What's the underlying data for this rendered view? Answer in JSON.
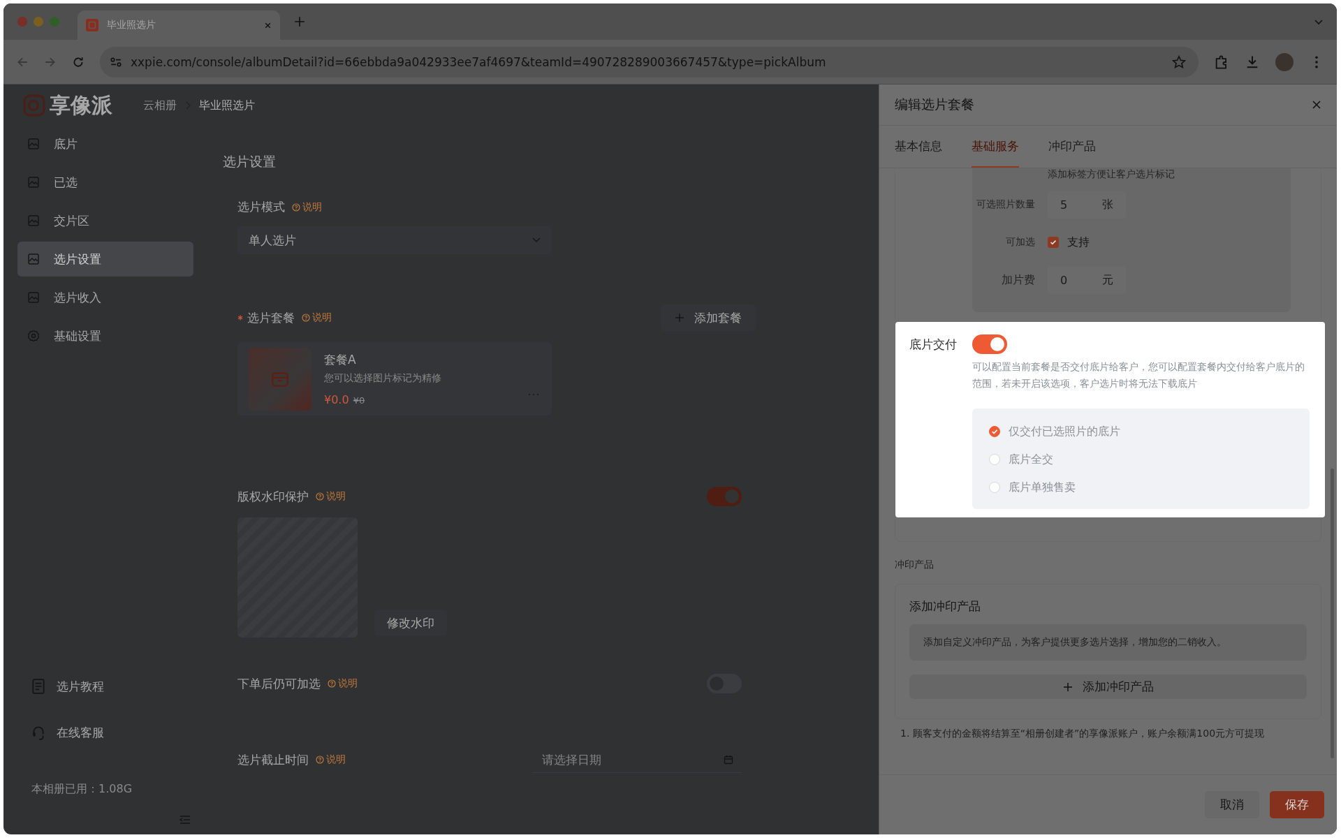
{
  "browser": {
    "tab_title": "毕业照选片",
    "url": "xxpie.com/console/albumDetail?id=66ebbda9a042933ee7af4697&teamId=490728289003667457&type=pickAlbum"
  },
  "app": {
    "logo": "享像派",
    "breadcrumb": [
      "云相册",
      "毕业照选片"
    ],
    "sidebar": {
      "items": [
        {
          "label": "底片",
          "selected": false
        },
        {
          "label": "已选",
          "selected": false
        },
        {
          "label": "交片区",
          "selected": false
        },
        {
          "label": "选片设置",
          "selected": true
        },
        {
          "label": "选片收入",
          "selected": false
        },
        {
          "label": "基础设置",
          "selected": false
        }
      ],
      "links": [
        "选片教程",
        "在线客服"
      ],
      "storage": "本相册已用：1.08G"
    }
  },
  "settings": {
    "title": "选片设置",
    "mode": {
      "label": "选片模式",
      "help": "说明",
      "value": "单人选片"
    },
    "package": {
      "label": "选片套餐",
      "required": true,
      "help": "说明",
      "add": "添加套餐",
      "items": [
        {
          "name": "套餐A",
          "desc": "您可以选择图片标记为精修",
          "price": "¥0.0",
          "original_price": "¥0"
        }
      ]
    },
    "watermark": {
      "label": "版权水印保护",
      "help": "说明",
      "on": true,
      "edit": "修改水印"
    },
    "addon": {
      "label": "下单后仍可加选",
      "help": "说明",
      "on": false
    },
    "deadline": {
      "label": "选片截止时间",
      "help": "说明",
      "placeholder": "请选择日期"
    }
  },
  "drawer": {
    "title": "编辑选片套餐",
    "tabs": [
      {
        "label": "基本信息",
        "selected": false
      },
      {
        "label": "基础服务",
        "selected": true
      },
      {
        "label": "冲印产品",
        "selected": false
      }
    ],
    "tag_hint": "添加标签方便让客户选片标记",
    "count": {
      "label": "可选照片数量",
      "value": "5",
      "unit": "张"
    },
    "extra": {
      "label": "可加选",
      "checked": true,
      "text": "支持"
    },
    "fee": {
      "label": "加片费",
      "value": "0",
      "unit": "元"
    },
    "delivery": {
      "label": "底片交付",
      "on": true,
      "desc": "可以配置当前套餐是否交付底片给客户，您可以配置套餐内交付给客户底片的范围，若未开启该选项，客户选片时将无法下载底片",
      "options": [
        {
          "label": "仅交付已选照片的底片",
          "selected": true
        },
        {
          "label": "底片全交",
          "selected": false
        },
        {
          "label": "底片单独售卖",
          "selected": false
        }
      ]
    },
    "print": {
      "section": "冲印产品",
      "title": "添加冲印产品",
      "hint": "添加自定义冲印产品，为客户提供更多选片选择，增加您的二销收入。",
      "add": "添加冲印产品"
    },
    "note": "1. 顾客支付的金额将结算至“相册创建者”的享像派账户，账户余额满100元方可提现",
    "buttons": [
      {
        "label": "取消",
        "kind": "secondary"
      },
      {
        "label": "保存",
        "kind": "primary"
      }
    ]
  }
}
